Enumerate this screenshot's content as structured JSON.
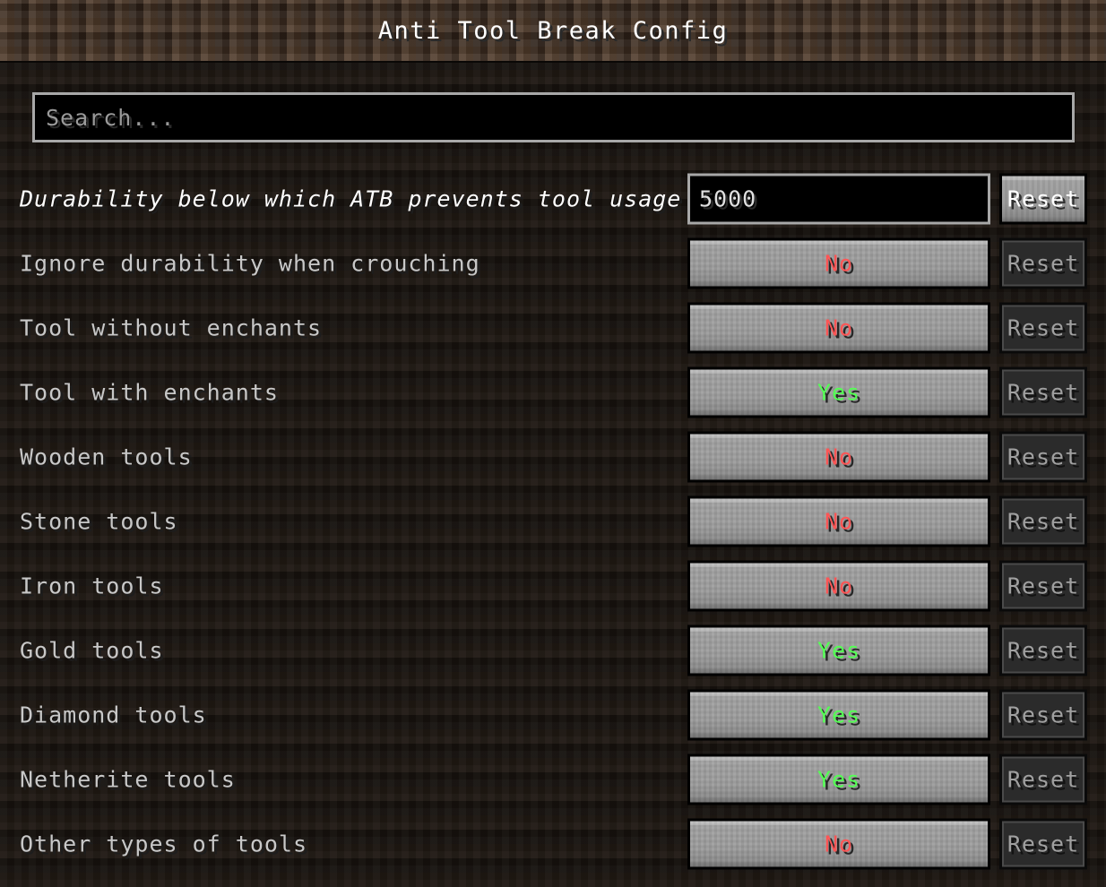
{
  "header": {
    "title": "Anti Tool Break Config"
  },
  "search": {
    "placeholder": "Search...",
    "value": ""
  },
  "labels": {
    "reset": "Reset",
    "yes": "Yes",
    "no": "No"
  },
  "colors": {
    "yes": "#55FF55",
    "no": "#FF5555",
    "label": "#C8C8C8",
    "label_modified": "#FFFFFF",
    "header_bg": "#392A1F",
    "body_bg": "#191410",
    "widget_face": "#9A9A9A",
    "widget_disabled": "#2B2B2B"
  },
  "options": [
    {
      "label": "Durability below which ATB prevents tool usage",
      "modified": true,
      "type": "text",
      "value": "5000",
      "reset_label": "Reset",
      "reset_enabled": true
    },
    {
      "label": "Ignore durability when crouching",
      "modified": false,
      "type": "toggle",
      "value": "No",
      "reset_label": "Reset",
      "reset_enabled": false
    },
    {
      "label": "Tool without enchants",
      "modified": false,
      "type": "toggle",
      "value": "No",
      "reset_label": "Reset",
      "reset_enabled": false
    },
    {
      "label": "Tool with enchants",
      "modified": false,
      "type": "toggle",
      "value": "Yes",
      "reset_label": "Reset",
      "reset_enabled": false
    },
    {
      "label": "Wooden tools",
      "modified": false,
      "type": "toggle",
      "value": "No",
      "reset_label": "Reset",
      "reset_enabled": false
    },
    {
      "label": "Stone tools",
      "modified": false,
      "type": "toggle",
      "value": "No",
      "reset_label": "Reset",
      "reset_enabled": false
    },
    {
      "label": "Iron tools",
      "modified": false,
      "type": "toggle",
      "value": "No",
      "reset_label": "Reset",
      "reset_enabled": false
    },
    {
      "label": "Gold tools",
      "modified": false,
      "type": "toggle",
      "value": "Yes",
      "reset_label": "Reset",
      "reset_enabled": false
    },
    {
      "label": "Diamond tools",
      "modified": false,
      "type": "toggle",
      "value": "Yes",
      "reset_label": "Reset",
      "reset_enabled": false
    },
    {
      "label": "Netherite tools",
      "modified": false,
      "type": "toggle",
      "value": "Yes",
      "reset_label": "Reset",
      "reset_enabled": false
    },
    {
      "label": "Other types of tools",
      "modified": false,
      "type": "toggle",
      "value": "No",
      "reset_label": "Reset",
      "reset_enabled": false
    }
  ]
}
